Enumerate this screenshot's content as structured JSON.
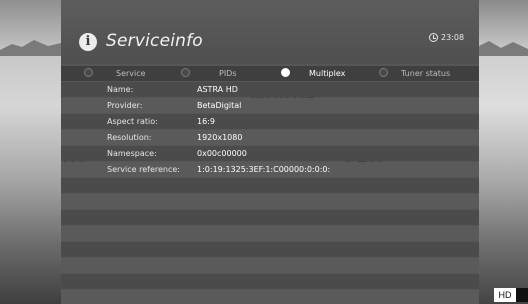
{
  "header": {
    "title": "Serviceinfo",
    "clock": "23:08",
    "icon": "info-icon"
  },
  "tabs": [
    {
      "label": "Service",
      "active": false
    },
    {
      "label": "PIDs",
      "active": false
    },
    {
      "label": "Multiplex",
      "active": true
    },
    {
      "label": "Tuner status",
      "active": false
    }
  ],
  "rows": [
    {
      "label": "Name:",
      "value": "ASTRA HD"
    },
    {
      "label": "Provider:",
      "value": "BetaDigital"
    },
    {
      "label": "Aspect ratio:",
      "value": "16:9"
    },
    {
      "label": "Resolution:",
      "value": "1920x1080"
    },
    {
      "label": "Namespace:",
      "value": "0x00c00000"
    },
    {
      "label": "Service reference:",
      "value": "1:0:19:1325:3EF:1:C00000:0:0:0:"
    }
  ],
  "badge": {
    "label": "HD"
  },
  "colors": {
    "panel": "#565656",
    "row_dark": "#4b4b4b",
    "row_light": "#5a5a5a",
    "text": "#ffffff"
  }
}
